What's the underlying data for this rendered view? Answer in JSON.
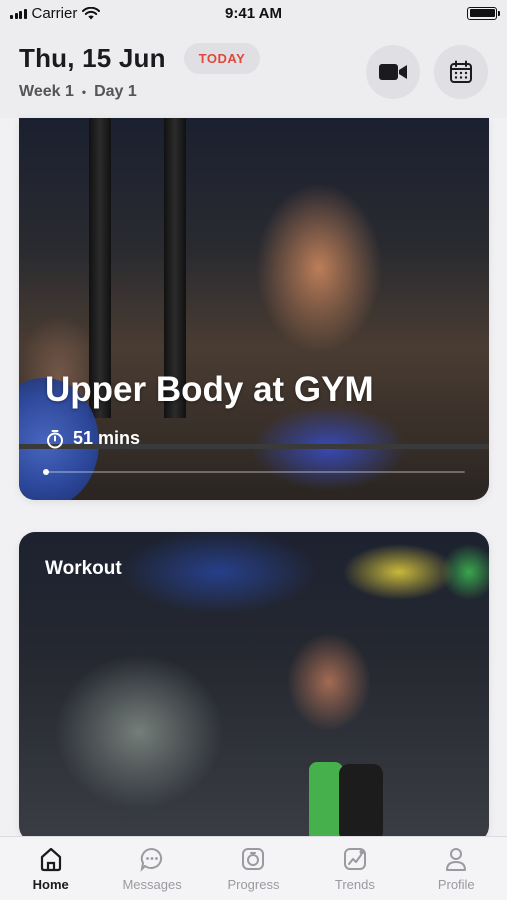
{
  "status_bar": {
    "carrier": "Carrier",
    "time": "9:41 AM"
  },
  "header": {
    "date": "Thu, 15 Jun",
    "today_label": "TODAY",
    "week": "Week 1",
    "separator": "•",
    "day": "Day 1",
    "video_icon": "video-camera-icon",
    "calendar_icon": "calendar-icon"
  },
  "cards": [
    {
      "title": "Upper Body at GYM",
      "duration": "51 mins",
      "duration_icon": "stopwatch-icon"
    },
    {
      "title": "Workout"
    }
  ],
  "tabs": [
    {
      "label": "Home",
      "icon": "home-icon",
      "active": true
    },
    {
      "label": "Messages",
      "icon": "chat-bubble-icon",
      "active": false
    },
    {
      "label": "Progress",
      "icon": "progress-icon",
      "active": false
    },
    {
      "label": "Trends",
      "icon": "trends-icon",
      "active": false
    },
    {
      "label": "Profile",
      "icon": "person-icon",
      "active": false
    }
  ],
  "colors": {
    "accent": "#e0483c",
    "text": "#1b1b1f",
    "inactive": "#9a9aa0"
  }
}
